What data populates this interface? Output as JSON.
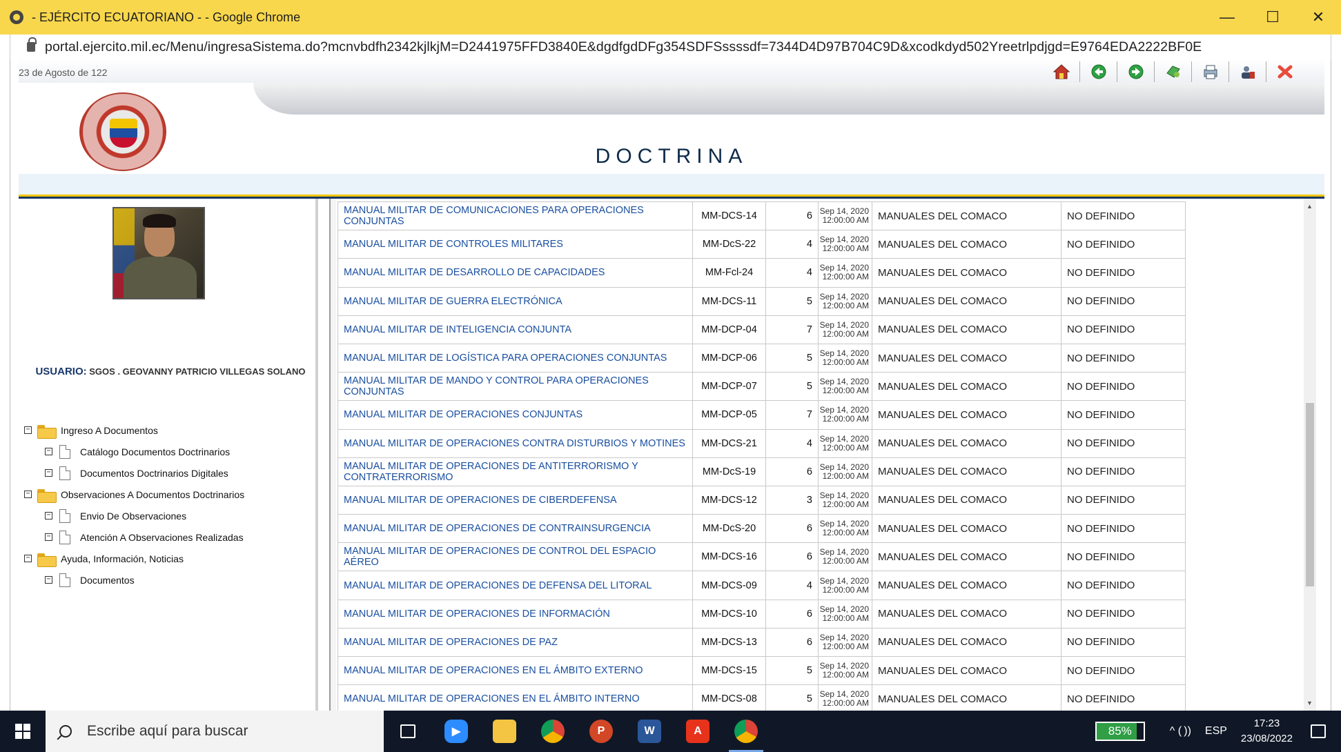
{
  "window": {
    "title": "- EJÉRCITO ECUATORIANO - - Google Chrome",
    "minimize": "—",
    "maximize": "☐",
    "close": "✕",
    "url": "portal.ejercito.mil.ec/Menu/ingresaSistema.do?mcnvbdfh2342kjlkjM=D2441975FFD3840E&dgdfgdDFg354SDFSssssdf=7344D4D97B704C9D&xcodkdyd502Yreetrlpdjgd=E9764EDA2222BF0E"
  },
  "header": {
    "date": "23 de Agosto de 122",
    "section_title": "DOCTRINA",
    "toolbar_icons": [
      "home-icon",
      "back-icon",
      "forward-icon",
      "refresh-icon",
      "print-icon",
      "user-settings-icon",
      "exit-icon"
    ]
  },
  "sidebar": {
    "user_label": "USUARIO:",
    "user_name": "SGOS . GEOVANNY PATRICIO VILLEGAS SOLANO",
    "tree": {
      "g1": {
        "label": "Ingreso A Documentos",
        "c1": "Catálogo Documentos Doctrinarios",
        "c2": "Documentos Doctrinarios Digitales"
      },
      "g2": {
        "label": "Observaciones A Documentos Doctrinarios",
        "c1": "Envio De Observaciones",
        "c2": "Atención A Observaciones Realizadas"
      },
      "g3": {
        "label": "Ayuda, Información, Noticias",
        "c1": "Documentos"
      }
    }
  },
  "table": {
    "rows": [
      {
        "title": "MANUAL MILITAR DE COMUNICACIONES PARA OPERACIONES CONJUNTAS",
        "code": "MM-DCS-14",
        "num": "6",
        "date": "Sep 14, 2020",
        "time": "12:00:00 AM",
        "category": "MANUALES DEL COMACO",
        "status": "NO DEFINIDO"
      },
      {
        "title": "MANUAL MILITAR DE CONTROLES MILITARES",
        "code": "MM-DcS-22",
        "num": "4",
        "date": "Sep 14, 2020",
        "time": "12:00:00 AM",
        "category": "MANUALES DEL COMACO",
        "status": "NO DEFINIDO"
      },
      {
        "title": "MANUAL MILITAR DE DESARROLLO DE CAPACIDADES",
        "code": "MM-Fcl-24",
        "num": "4",
        "date": "Sep 14, 2020",
        "time": "12:00:00 AM",
        "category": "MANUALES DEL COMACO",
        "status": "NO DEFINIDO"
      },
      {
        "title": "MANUAL MILITAR DE GUERRA ELECTRÓNICA",
        "code": "MM-DCS-11",
        "num": "5",
        "date": "Sep 14, 2020",
        "time": "12:00:00 AM",
        "category": "MANUALES DEL COMACO",
        "status": "NO DEFINIDO"
      },
      {
        "title": "MANUAL MILITAR DE INTELIGENCIA CONJUNTA",
        "code": "MM-DCP-04",
        "num": "7",
        "date": "Sep 14, 2020",
        "time": "12:00:00 AM",
        "category": "MANUALES DEL COMACO",
        "status": "NO DEFINIDO"
      },
      {
        "title": "MANUAL MILITAR DE LOGÍSTICA PARA OPERACIONES CONJUNTAS",
        "code": "MM-DCP-06",
        "num": "5",
        "date": "Sep 14, 2020",
        "time": "12:00:00 AM",
        "category": "MANUALES DEL COMACO",
        "status": "NO DEFINIDO"
      },
      {
        "title": "MANUAL MILITAR DE MANDO Y CONTROL PARA OPERACIONES CONJUNTAS",
        "code": "MM-DCP-07",
        "num": "5",
        "date": "Sep 14, 2020",
        "time": "12:00:00 AM",
        "category": "MANUALES DEL COMACO",
        "status": "NO DEFINIDO"
      },
      {
        "title": "MANUAL MILITAR DE OPERACIONES CONJUNTAS",
        "code": "MM-DCP-05",
        "num": "7",
        "date": "Sep 14, 2020",
        "time": "12:00:00 AM",
        "category": "MANUALES DEL COMACO",
        "status": "NO DEFINIDO"
      },
      {
        "title": "MANUAL MILITAR DE OPERACIONES CONTRA DISTURBIOS Y MOTINES",
        "code": "MM-DCS-21",
        "num": "4",
        "date": "Sep 14, 2020",
        "time": "12:00:00 AM",
        "category": "MANUALES DEL COMACO",
        "status": "NO DEFINIDO"
      },
      {
        "title": "MANUAL MILITAR DE OPERACIONES DE ANTITERRORISMO Y CONTRATERRORISMO",
        "code": "MM-DcS-19",
        "num": "6",
        "date": "Sep 14, 2020",
        "time": "12:00:00 AM",
        "category": "MANUALES DEL COMACO",
        "status": "NO DEFINIDO"
      },
      {
        "title": "MANUAL MILITAR DE OPERACIONES DE CIBERDEFENSA",
        "code": "MM-DCS-12",
        "num": "3",
        "date": "Sep 14, 2020",
        "time": "12:00:00 AM",
        "category": "MANUALES DEL COMACO",
        "status": "NO DEFINIDO"
      },
      {
        "title": "MANUAL MILITAR DE OPERACIONES DE CONTRAINSURGENCIA",
        "code": "MM-DcS-20",
        "num": "6",
        "date": "Sep 14, 2020",
        "time": "12:00:00 AM",
        "category": "MANUALES DEL COMACO",
        "status": "NO DEFINIDO"
      },
      {
        "title": "MANUAL MILITAR DE OPERACIONES DE CONTROL DEL ESPACIO AÉREO",
        "code": "MM-DCS-16",
        "num": "6",
        "date": "Sep 14, 2020",
        "time": "12:00:00 AM",
        "category": "MANUALES DEL COMACO",
        "status": "NO DEFINIDO"
      },
      {
        "title": "MANUAL MILITAR DE OPERACIONES DE DEFENSA DEL LITORAL",
        "code": "MM-DCS-09",
        "num": "4",
        "date": "Sep 14, 2020",
        "time": "12:00:00 AM",
        "category": "MANUALES DEL COMACO",
        "status": "NO DEFINIDO"
      },
      {
        "title": "MANUAL MILITAR DE OPERACIONES DE INFORMACIÓN",
        "code": "MM-DCS-10",
        "num": "6",
        "date": "Sep 14, 2020",
        "time": "12:00:00 AM",
        "category": "MANUALES DEL COMACO",
        "status": "NO DEFINIDO"
      },
      {
        "title": "MANUAL MILITAR DE OPERACIONES DE PAZ",
        "code": "MM-DCS-13",
        "num": "6",
        "date": "Sep 14, 2020",
        "time": "12:00:00 AM",
        "category": "MANUALES DEL COMACO",
        "status": "NO DEFINIDO"
      },
      {
        "title": "MANUAL MILITAR DE OPERACIONES EN EL ÁMBITO EXTERNO",
        "code": "MM-DCS-15",
        "num": "5",
        "date": "Sep 14, 2020",
        "time": "12:00:00 AM",
        "category": "MANUALES DEL COMACO",
        "status": "NO DEFINIDO"
      },
      {
        "title": "MANUAL MILITAR DE OPERACIONES EN EL ÁMBITO INTERNO",
        "code": "MM-DCS-08",
        "num": "5",
        "date": "Sep 14, 2020",
        "time": "12:00:00 AM",
        "category": "MANUALES DEL COMACO",
        "status": "NO DEFINIDO"
      }
    ]
  },
  "taskbar": {
    "search_placeholder": "Escribe aquí para buscar",
    "apps": [
      "task-view-icon",
      "zoom-icon",
      "file-explorer-icon",
      "chrome-icon",
      "powerpoint-icon",
      "word-icon",
      "acrobat-icon",
      "chrome-profile-icon"
    ],
    "battery": "85%",
    "battery_level": 0.85,
    "tray_symbols": "^ ( ))",
    "language": "ESP",
    "time": "17:23",
    "date": "23/08/2022"
  }
}
